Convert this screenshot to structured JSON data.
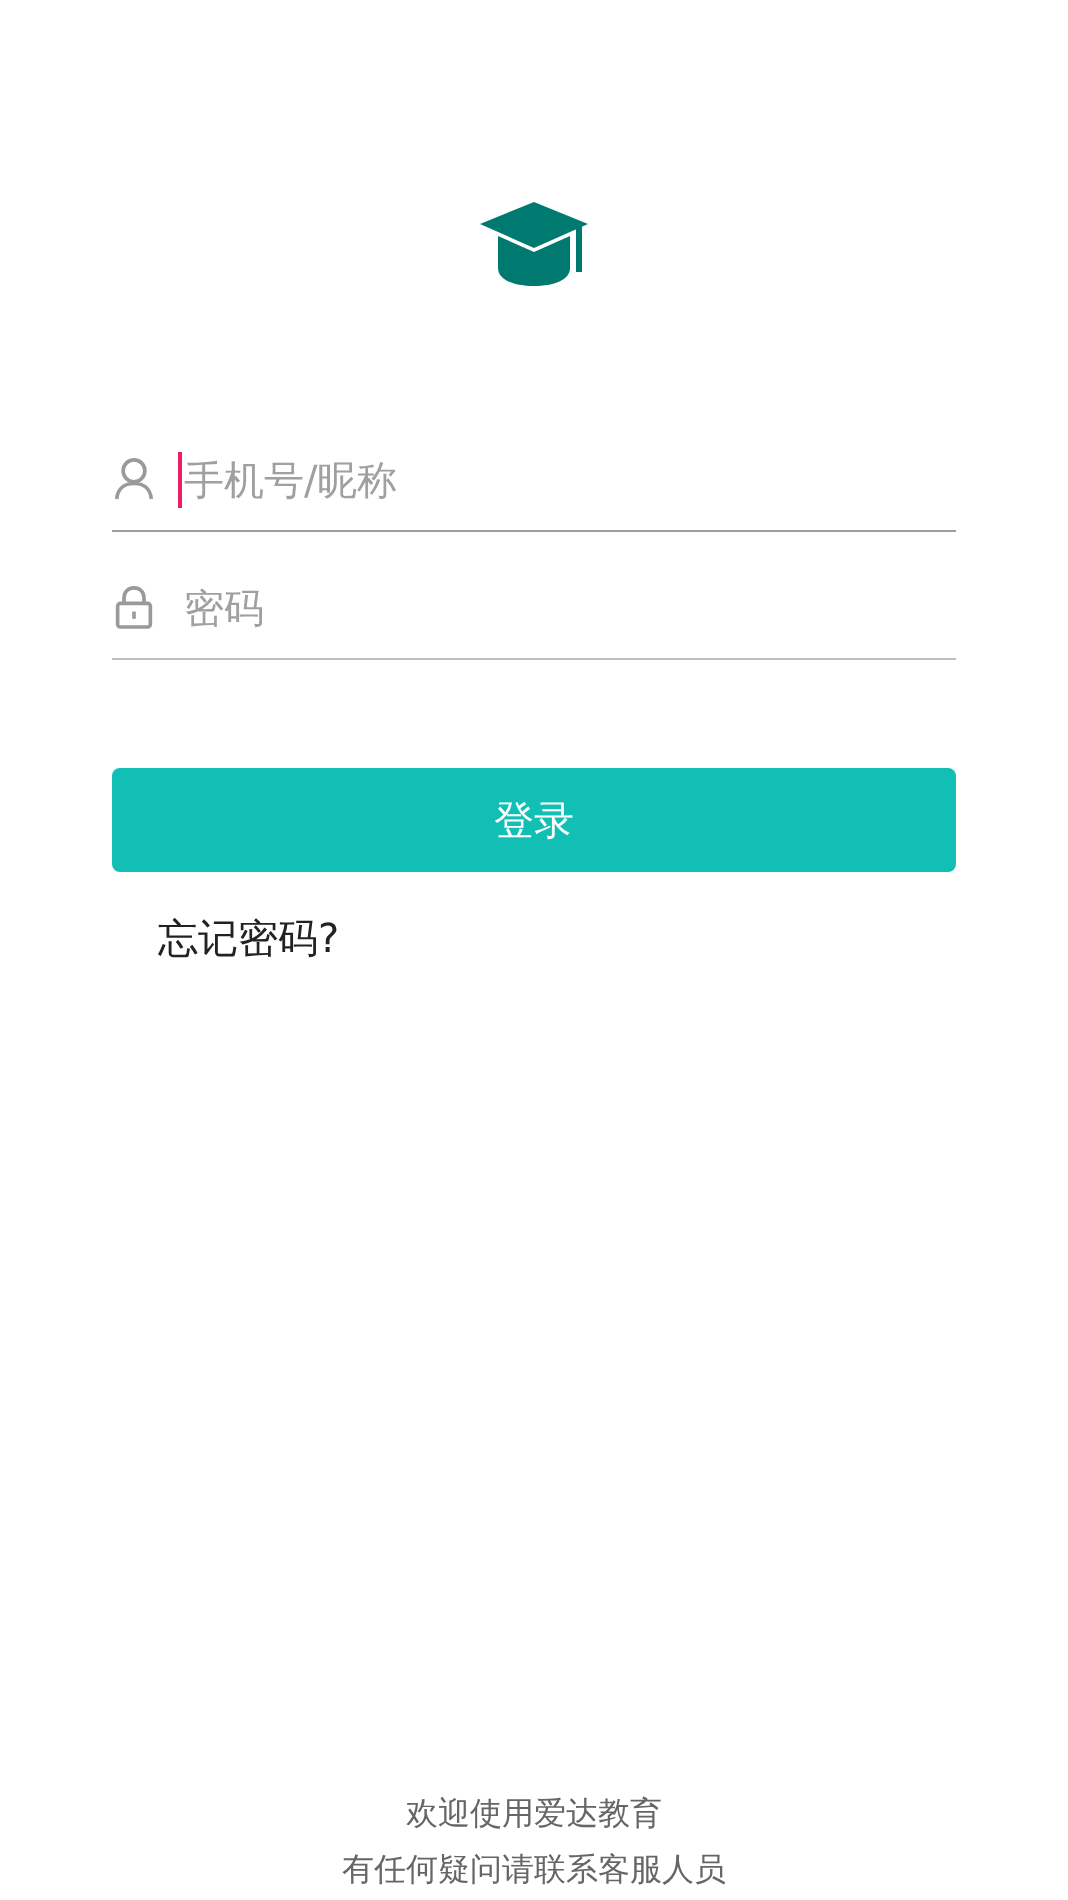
{
  "fields": [
    {
      "kind": "user",
      "placeholder": "手机号/昵称",
      "focused": true
    },
    {
      "kind": "lock",
      "placeholder": "密码",
      "focused": false
    }
  ],
  "login_button": "登录",
  "forgot_link": "忘记密码?",
  "footer": [
    "欢迎使用爱达教育",
    "有任何疑问请联系客服人员"
  ]
}
